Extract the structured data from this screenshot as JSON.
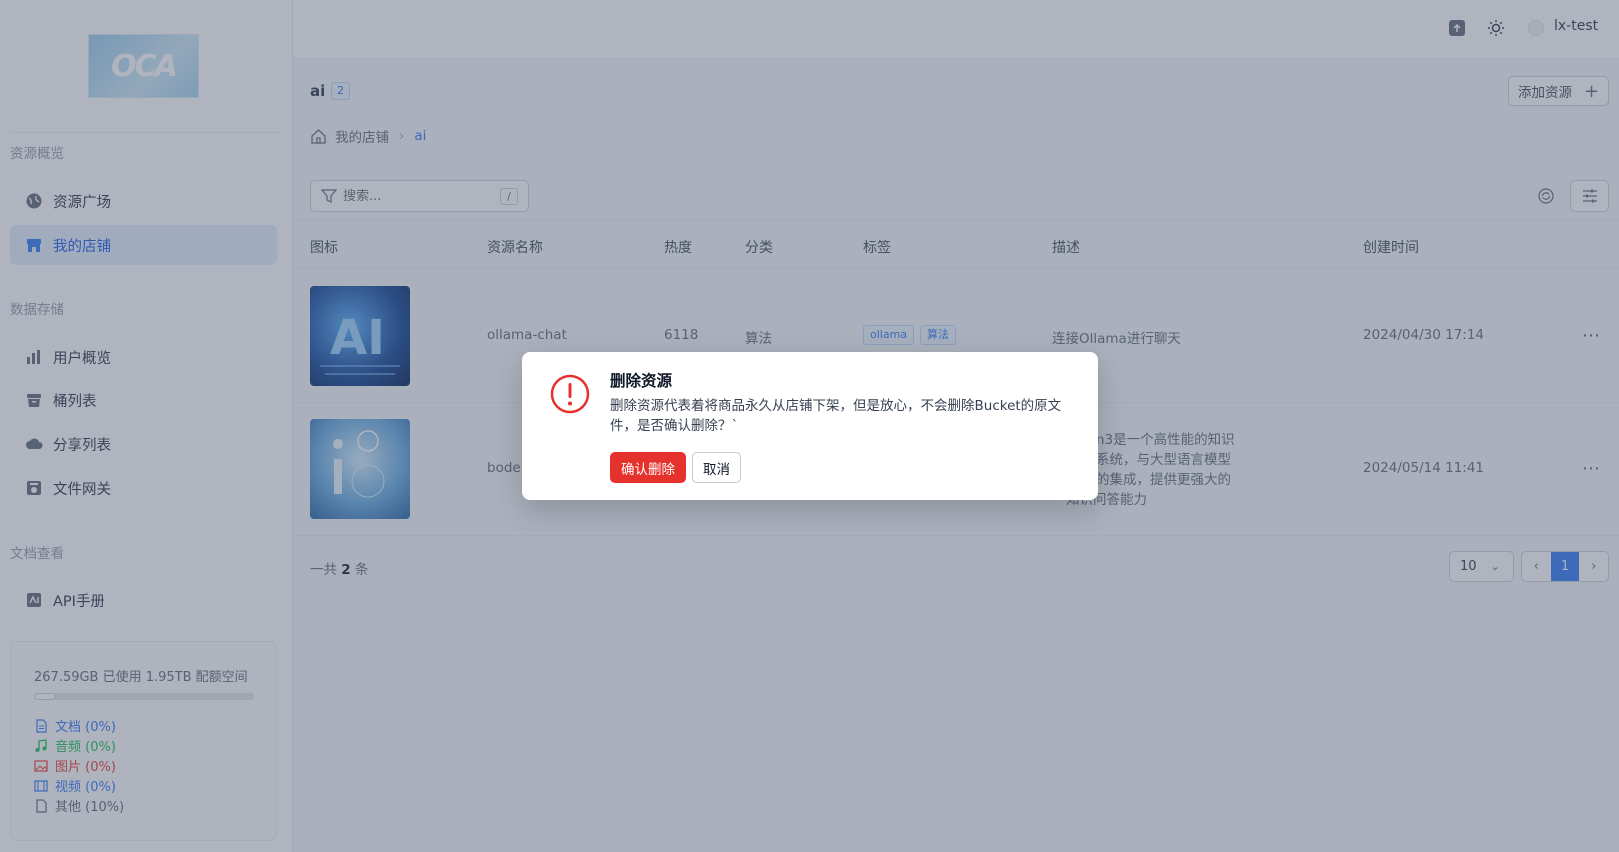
{
  "logo": {
    "text": "OCA"
  },
  "sidebar": {
    "sections": [
      {
        "title": "资源概览"
      },
      {
        "title": "数据存储"
      },
      {
        "title": "文档查看"
      }
    ],
    "items": [
      {
        "label": "资源广场",
        "icon": "globe-icon"
      },
      {
        "label": "我的店铺",
        "icon": "store-icon",
        "active": true
      },
      {
        "label": "用户概览",
        "icon": "bar-chart-icon"
      },
      {
        "label": "桶列表",
        "icon": "bucket-icon"
      },
      {
        "label": "分享列表",
        "icon": "cloud-share-icon"
      },
      {
        "label": "文件网关",
        "icon": "gateway-icon"
      },
      {
        "label": "API手册",
        "icon": "api-book-icon"
      }
    ],
    "storage": {
      "used_text": "267.59GB 已使用   1.95TB 配额空间",
      "used_fraction": 0.1,
      "legend": [
        {
          "label": "文档 (0%)",
          "color": "#3b82f6"
        },
        {
          "label": "音频 (0%)",
          "color": "#22c55e"
        },
        {
          "label": "图片 (0%)",
          "color": "#ef4444"
        },
        {
          "label": "视频 (0%)",
          "color": "#3b82f6"
        },
        {
          "label": "其他 (10%)",
          "color": "#6b7280"
        }
      ]
    }
  },
  "header": {
    "user_name": "lx-test",
    "icons": [
      "upload-icon",
      "theme-sun-icon"
    ]
  },
  "page": {
    "title": "ai",
    "badge": "2",
    "add_button": "添加资源",
    "breadcrumb": [
      "我的店铺",
      "ai"
    ],
    "search_placeholder": "搜索...",
    "search_shortcut": "/"
  },
  "table": {
    "columns": [
      "图标",
      "资源名称",
      "热度",
      "分类",
      "标签",
      "描述",
      "创建时间"
    ],
    "rows": [
      {
        "name": "ollama-chat",
        "heat": "6118",
        "category": "算法",
        "tags": [
          "ollama",
          "算法"
        ],
        "description": "连接Ollama进行聊天",
        "created": "2024/04/30 17:14"
      },
      {
        "name": "bode",
        "heat": "",
        "category": "",
        "tags": [],
        "description_lines": [
          "n3是一个高性能的知识",
          "系统，与大型语言模型",
          "的集成，提供更强大的",
          "知识问答能力"
        ],
        "created": "2024/05/14 11:41"
      }
    ]
  },
  "pagination": {
    "total_prefix": "一共",
    "total_count": "2",
    "total_suffix": "条",
    "page_size": "10",
    "current_page": "1"
  },
  "dialog": {
    "title": "删除资源",
    "body": "删除资源代表着将商品永久从店铺下架，但是放心，不会删除Bucket的原文件，是否确认删除？`",
    "confirm_label": "确认删除",
    "cancel_label": "取消",
    "accent_color": "#e5322d"
  }
}
